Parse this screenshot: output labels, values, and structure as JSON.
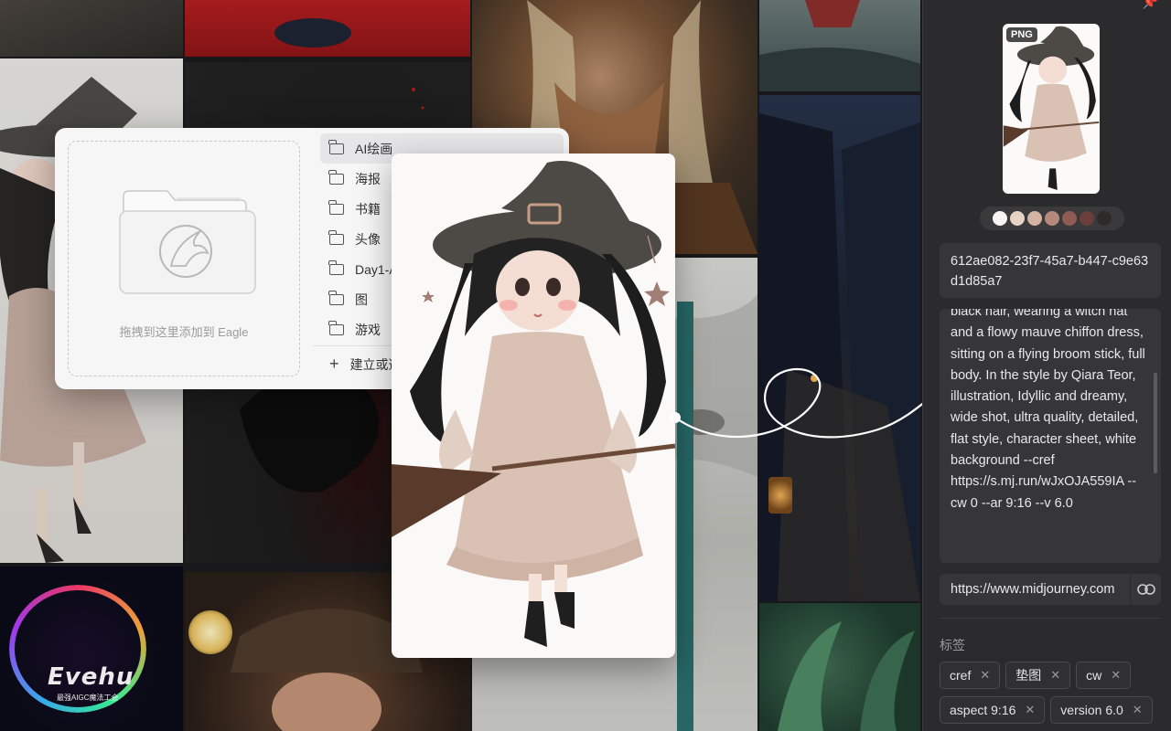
{
  "popup": {
    "drop_label": "拖拽到这里添加到 Eagle",
    "folders": [
      {
        "label": "AI绘画",
        "active": true
      },
      {
        "label": "海报"
      },
      {
        "label": "书籍"
      },
      {
        "label": "头像"
      },
      {
        "label": "Day1-AI"
      },
      {
        "label": "图"
      },
      {
        "label": "游戏"
      }
    ],
    "new_folder_label": "建立或选择"
  },
  "gallery": {
    "logo_text": "Evehu",
    "logo_sub": "最强AIGC魔法工会"
  },
  "inspector": {
    "format_badge": "PNG",
    "palette": [
      "#f7f5f1",
      "#e7d3c5",
      "#d5b3a4",
      "#b58a7c",
      "#8f5b52",
      "#6a3f3b",
      "#2d2a29"
    ],
    "uuid": "612ae082-23f7-45a7-b447-c9e63d1d85a7",
    "prompt": "black hair, wearing a witch hat and a flowy mauve chiffon dress, sitting on a flying broom stick, full body. In the style by Qiara Teor, illustration, Idyllic and dreamy, wide shot, ultra quality, detailed, flat style, character sheet, white background --cref https://s.mj.run/wJxOJA559IA --cw 0 --ar 9:16 --v 6.0",
    "url": "https://www.midjourney.com",
    "tags_label": "标签",
    "tags": [
      "cref",
      "垫图",
      "cw",
      "aspect 9:16",
      "version 6.0"
    ]
  },
  "colors": {
    "panel_bg": "#2b2b2e",
    "field_bg": "#363639",
    "popup_bg": "#f6f6f6"
  }
}
